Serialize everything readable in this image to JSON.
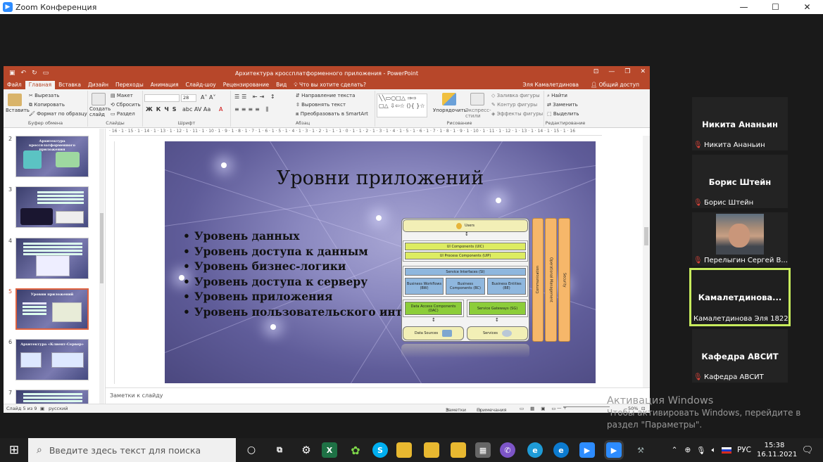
{
  "window": {
    "title": "Zoom Конференция",
    "min": "—",
    "max": "☐",
    "close": "✕"
  },
  "ppt": {
    "title": "Архитектура кроссплатформенного приложения - PowerPoint",
    "tabs": [
      "Файл",
      "Главная",
      "Вставка",
      "Дизайн",
      "Переходы",
      "Анимация",
      "Слайд-шоу",
      "Рецензирование",
      "Вид"
    ],
    "tell_me": "Что вы хотите сделать?",
    "user": "Эля Камалетдинова",
    "share": "Общий доступ",
    "ribbon": {
      "paste": "Вставить",
      "cut": "Вырезать",
      "copy": "Копировать",
      "format_painter": "Формат по образцу",
      "clipboard_group": "Буфер обмена",
      "new_slide": "Создать слайд",
      "layout": "Макет",
      "reset": "Сбросить",
      "section": "Раздел",
      "slides_group": "Слайды",
      "font_size": "28",
      "font_group": "Шрифт",
      "text_direction": "Направление текста",
      "align_text": "Выровнять текст",
      "smartart": "Преобразовать в SmartArt",
      "paragraph_group": "Абзац",
      "arrange": "Упорядочить",
      "quick_styles": "Экспресс-стили",
      "shape_fill": "Заливка фигуры",
      "shape_outline": "Контур фигуры",
      "shape_effects": "Эффекты фигуры",
      "drawing_group": "Рисование",
      "find": "Найти",
      "replace": "Заменить",
      "select": "Выделить",
      "editing_group": "Редактирование"
    },
    "ruler": "· 16 · 1 · 15 · 1 · 14 · 1 · 13 · 1 · 12 · 1 · 11 · 1 · 10 · 1 · 9 · 1 · 8 · 1 · 7 · 1 · 6 · 1 · 5 · 1 · 4 · 1 · 3 · 1 · 2 · 1 · 1 · 1 · 0 · 1 · 1 · 2 · 1 · 3 · 1 · 4 · 1 · 5 · 1 · 6 · 1 · 7 · 1 · 8 · 1 · 9 · 1 · 10 · 1 · 11 · 1 · 12 · 1 · 13 · 1 · 14 · 1 · 15 · 1 · 16",
    "thumbnails": [
      {
        "n": "2",
        "title": "Архитектура кроссплатформенного приложения"
      },
      {
        "n": "3",
        "title": ""
      },
      {
        "n": "4",
        "title": ""
      },
      {
        "n": "5",
        "title": "Уровни приложений"
      },
      {
        "n": "6",
        "title": "Архитектура «Клиент-Сервер»"
      },
      {
        "n": "7",
        "title": ""
      }
    ],
    "slide": {
      "title": "Уровни приложений",
      "bullets": [
        "Уровень данных",
        "Уровень доступа к данным",
        "Уровень бизнес-логики",
        "Уровень доступа к серверу",
        "Уровень приложения",
        "Уровень пользовательского интерфейса"
      ],
      "diagram": {
        "users": "Users",
        "uic": "UI Components (UIC)",
        "uip": "UI Process Components (UIP)",
        "si": "Service Interfaces (SI)",
        "bw": "Business Workflows (BW)",
        "bc": "Business Components (BC)",
        "be": "Business Entities (BE)",
        "dac": "Data Access Components (DAC)",
        "sg": "Service Gateways (SG)",
        "data_sources": "Data Sources",
        "services": "Services",
        "communication": "Communication",
        "op_mgmt": "Operational Management",
        "security": "Security"
      }
    },
    "notes": "Заметки к слайду",
    "status": {
      "slide": "Слайд 5 из 9",
      "lang": "русский",
      "notes": "Заметки",
      "comments": "Примечания",
      "zoom": "50%"
    }
  },
  "participants": [
    {
      "name": "Никита Ананьин",
      "label": "Никита Ананьин",
      "muted": true,
      "active": false,
      "video": false
    },
    {
      "name": "Борис Штейн",
      "label": "Борис Штейн",
      "muted": true,
      "active": false,
      "video": false
    },
    {
      "name": "",
      "label": "Перелыгин Сергей В...",
      "muted": true,
      "active": false,
      "video": true
    },
    {
      "name": "Камалетдинова...",
      "label": "Камалетдинова Эля 1822",
      "muted": false,
      "active": true,
      "video": false
    },
    {
      "name": "Кафедра АВСИТ",
      "label": "Кафедра АВСИТ",
      "muted": true,
      "active": false,
      "video": false
    }
  ],
  "activation": {
    "line1": "Активация Windows",
    "line2": "Чтобы активировать Windows, перейдите в",
    "line3": "раздел \"Параметры\"."
  },
  "taskbar": {
    "search_placeholder": "Введите здесь текст для поиска",
    "lang": "РУС",
    "time": "15:38",
    "date": "16.11.2021"
  },
  "colors": {
    "ppt_accent": "#b7472a",
    "zoom_active": "#c8ec5d",
    "mic_muted": "#e0443a"
  }
}
